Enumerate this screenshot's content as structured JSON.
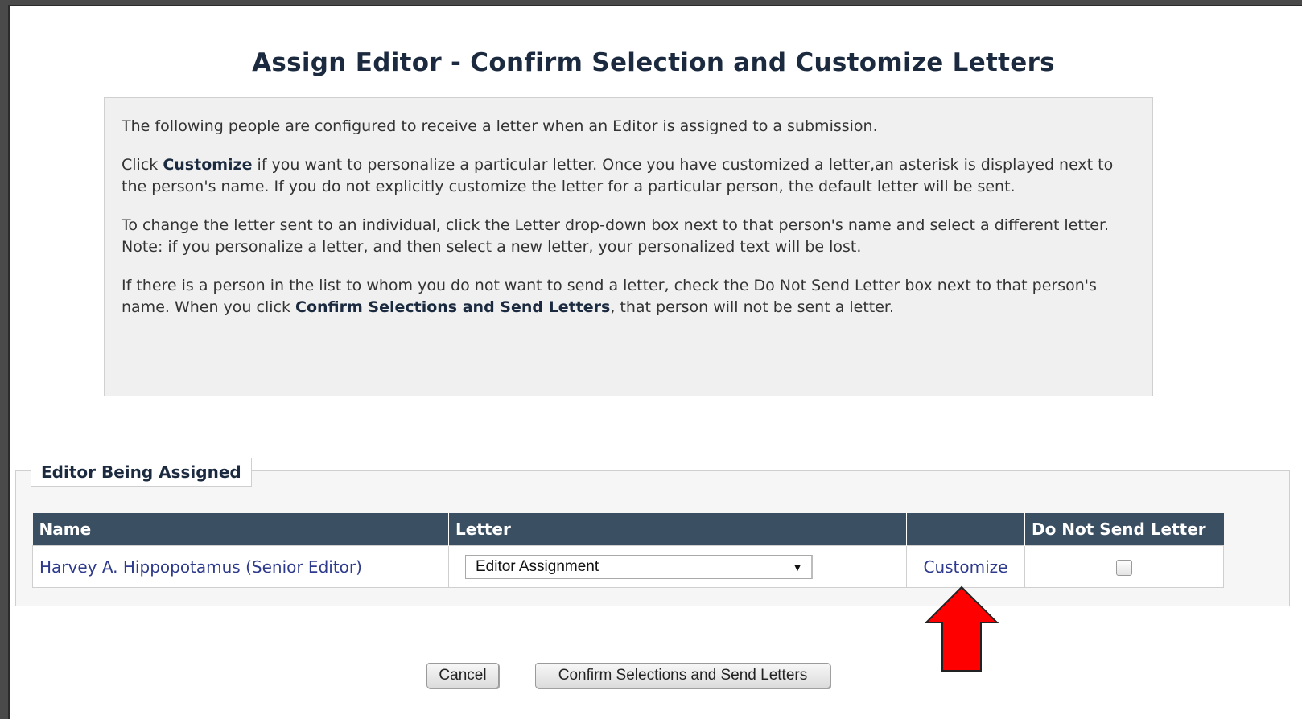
{
  "page_title": "Assign Editor - Confirm Selection and Customize Letters",
  "instructions": {
    "p1": "The following people are configured to receive a letter when an Editor is assigned to a submission.",
    "p2_pre": "Click ",
    "p2_bold": "Customize",
    "p2_post": " if you want to personalize a particular letter. Once you have customized a letter,an asterisk is displayed next to the person's name. If you do not explicitly customize the letter for a particular person, the default letter will be sent.",
    "p3": "To change the letter sent to an individual, click the Letter drop-down box next to that person's name and select a different letter. Note: if you personalize a letter, and then select a new letter, your personalized text will be lost.",
    "p4_pre": "If there is a person in the list to whom you do not want to send a letter, check the Do Not Send Letter box next to that person's name. When you click ",
    "p4_bold": "Confirm Selections and Send Letters",
    "p4_post": ", that person will not be sent a letter."
  },
  "section": {
    "legend": "Editor Being Assigned",
    "columns": {
      "name": "Name",
      "letter": "Letter",
      "customize": "",
      "do_not_send": "Do Not Send Letter"
    },
    "rows": [
      {
        "name": "Harvey A. Hippopotamus (Senior Editor)",
        "letter": "Editor Assignment",
        "customize_label": "Customize",
        "do_not_send_checked": false
      }
    ]
  },
  "buttons": {
    "cancel": "Cancel",
    "confirm": "Confirm Selections and Send Letters"
  },
  "icons": {
    "dropdown": "chevron-down-icon",
    "pointer": "red-arrow-up-icon"
  },
  "colors": {
    "header_bg": "#3b4f62",
    "link": "#2e3a8c",
    "annotation_arrow": "#ff0000"
  }
}
